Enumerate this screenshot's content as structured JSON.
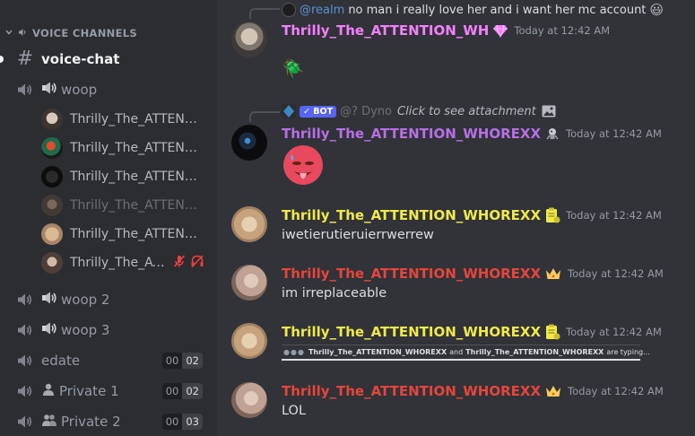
{
  "sidebar": {
    "category_label": "VOICE CHANNELS",
    "channels": [
      {
        "name": "voice-chat",
        "type": "text",
        "active": true
      },
      {
        "name": "woop",
        "type": "voice",
        "emoji": "🔊"
      },
      {
        "name": "woop 2",
        "type": "voice",
        "emoji": "🔊"
      },
      {
        "name": "woop 3",
        "type": "voice",
        "emoji": "🔊"
      },
      {
        "name": "edate",
        "type": "voice",
        "count_a": "00",
        "count_b": "02"
      },
      {
        "name": "Private 1",
        "type": "voice",
        "emoji": "👤",
        "count_a": "00",
        "count_b": "02"
      },
      {
        "name": "Private 2",
        "type": "voice",
        "emoji": "👥",
        "count_a": "00",
        "count_b": "03"
      }
    ],
    "voice_users": [
      {
        "name": "Thrilly_The_ATTENTIO...",
        "dim": false
      },
      {
        "name": "Thrilly_The_ATTENTIO...",
        "dim": false
      },
      {
        "name": "Thrilly_The_ATTENTIO...",
        "dim": false
      },
      {
        "name": "Thrilly_The_ATTENTIO...",
        "dim": true
      },
      {
        "name": "Thrilly_The_ATTENTIO...",
        "dim": false
      },
      {
        "name": "Thrilly_The_AT...",
        "dim": false,
        "muted": true,
        "deafened": true
      }
    ]
  },
  "chat": {
    "messages": [
      {
        "reply": {
          "mention": "@realm",
          "text": "no man i really love her and i want her mc account",
          "emoji": "😃"
        },
        "author": "Thrilly_The_ATTENTION_WH",
        "author_color": "#f47fff",
        "badge": "gem",
        "time": "Today at 12:42 AM",
        "content_emoji": "🪲"
      },
      {
        "reply": {
          "bot_label": "✓ BOT",
          "mention": "@? Dyno",
          "text": "Click to see attachment"
        },
        "author": "Thrilly_The_ATTENTION_WHOREXX",
        "author_color": "#b76fe6",
        "badge": "robot",
        "time": "Today at 12:42 AM",
        "content_emoji": "🥵"
      },
      {
        "author": "Thrilly_The_ATTENTION_WHOREXX",
        "author_color": "#f1e94a",
        "badge": "clipboard",
        "time": "Today at 12:42 AM",
        "content": "iwetierutieruierrwerrew"
      },
      {
        "author": "Thrilly_The_ATTENTION_WHOREXX",
        "author_color": "#e7453b",
        "badge": "crown",
        "time": "Today at 12:42 AM",
        "content": "im irreplaceable"
      },
      {
        "author": "Thrilly_The_ATTENTION_WHOREXX",
        "author_color": "#f1e94a",
        "badge": "clipboard",
        "time": "Today at 12:42 AM",
        "typing": {
          "user1": "Thrilly_The_ATTENTION_WHOREXX",
          "connector": "and",
          "user2": "Thrilly_The_ATTENTION_WHOREXX",
          "suffix": "are typing..."
        }
      },
      {
        "author": "Thrilly_The_ATTENTION_WHOREXX",
        "author_color": "#e7453b",
        "badge": "crown",
        "time": "Today at 12:42 AM",
        "content": "LOL"
      }
    ]
  }
}
